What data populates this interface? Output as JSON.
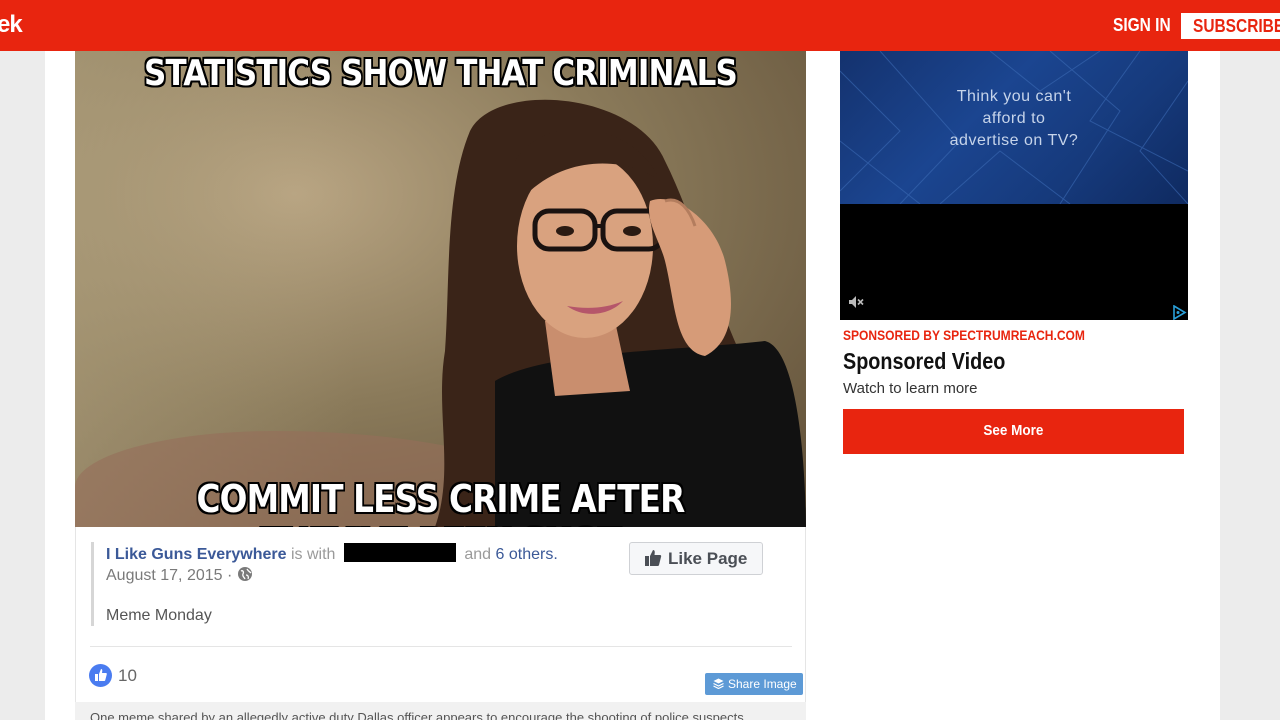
{
  "header": {
    "logo_fragment": "ek",
    "sign_in_label": "SIGN IN",
    "subscribe_label": "SUBSCRIBE",
    "brand_color": "#e8250f"
  },
  "meme": {
    "top_text": "STATISTICS SHOW THAT CRIMINALS",
    "bottom_text": "COMMIT LESS CRIME AFTER THEY'VE BEEN SHOT"
  },
  "facebook_post": {
    "page_name": "I Like Guns Everywhere",
    "is_with": "is with",
    "and": "and",
    "others": "6 others.",
    "date": "August 17, 2015 ·",
    "text": "Meme Monday",
    "like_page_label": "Like Page",
    "reaction_count": "10",
    "share_image_label": "Share Image"
  },
  "article": {
    "caption": "One meme shared by an allegedly active duty Dallas officer appears to encourage the shooting of police suspects."
  },
  "ad": {
    "banner_lines": [
      "Think you can't",
      "afford to",
      "advertise on TV?"
    ],
    "sponsor": "SPONSORED BY SPECTRUMREACH.COM",
    "title": "Sponsored Video",
    "description": "Watch to learn more",
    "cta_label": "See More"
  },
  "icons": [
    "globe-icon",
    "thumbs-up-icon",
    "like-reaction-icon",
    "layers-icon",
    "mute-icon",
    "adchoices-icon"
  ]
}
